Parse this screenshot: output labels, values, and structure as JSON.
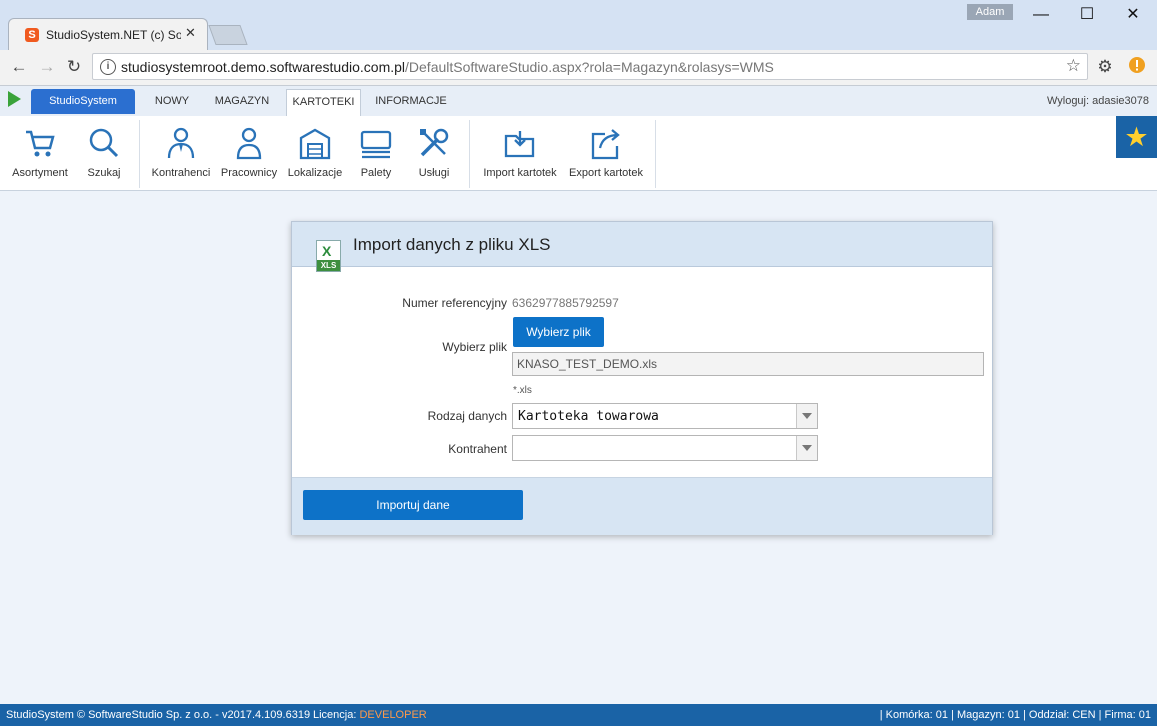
{
  "browser": {
    "tab_title": "StudioSystem.NET (c) Sof",
    "favicon_letter": "S",
    "user_name": "Adam",
    "url_host": "studiosystemroot.demo.softwarestudio.com.pl",
    "url_path": "/DefaultSoftwareStudio.aspx?rola=Magazyn&rolasys=WMS"
  },
  "appbar": {
    "brand": "StudioSystem",
    "menu": [
      "NOWY",
      "MAGAZYN",
      "KARTOTEKI",
      "INFORMACJE"
    ],
    "active_menu": "KARTOTEKI",
    "logout": "Wyloguj: adasie3078"
  },
  "toolbar": {
    "items": [
      {
        "label": "Asortyment",
        "icon": "cart-icon"
      },
      {
        "label": "Szukaj",
        "icon": "search-icon"
      },
      {
        "label": "Kontrahenci",
        "icon": "contractor-icon"
      },
      {
        "label": "Pracownicy",
        "icon": "person-icon"
      },
      {
        "label": "Lokalizacje",
        "icon": "warehouse-icon"
      },
      {
        "label": "Palety",
        "icon": "pallet-icon"
      },
      {
        "label": "Usługi",
        "icon": "tools-icon"
      },
      {
        "label": "Import kartotek",
        "icon": "import-folder-icon"
      },
      {
        "label": "Export kartotek",
        "icon": "export-icon"
      }
    ]
  },
  "form": {
    "title": "Import danych z pliku XLS",
    "file_icon_tag": "XLS",
    "ref_label": "Numer referencyjny",
    "ref_value": "6362977885792597",
    "file_label": "Wybierz plik",
    "pick_button": "Wybierz plik",
    "file_name": "KNASO_TEST_DEMO.xls",
    "file_hint": "*.xls",
    "type_label": "Rodzaj danych",
    "type_value": "Kartoteka towarowa",
    "contractor_label": "Kontrahent",
    "contractor_value": "",
    "import_button": "Importuj dane"
  },
  "statusbar": {
    "copyright": "StudioSystem © SoftwareStudio Sp. z o.o. - v2017.4.109.6319",
    "license_label": "Licencja:",
    "license_value": "DEVELOPER",
    "info": "| Komórka: 01 | Magazyn: 01 | Oddział: CEN | Firma: 01"
  },
  "colors": {
    "primary": "#0d72c8",
    "statusbar": "#1a63a6",
    "license": "#ff9a4a"
  }
}
